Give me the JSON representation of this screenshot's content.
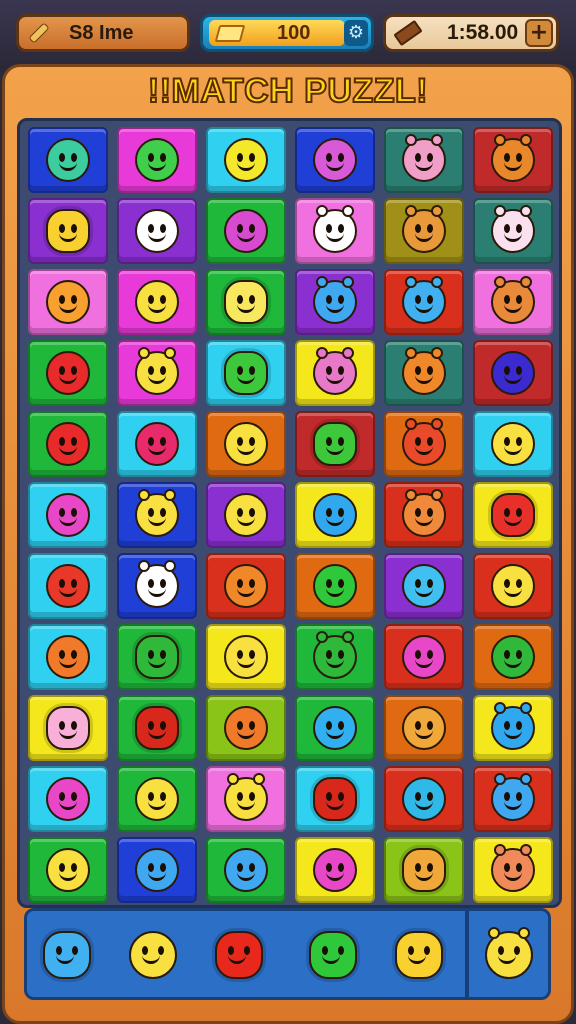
{
  "hud": {
    "player_label": "S8 Ime",
    "coins_value": "100",
    "timer_value": "1:58.00",
    "plus_label": "+",
    "settings_icon": "gear-icon"
  },
  "title": "!!MATCH PUZZL!",
  "colors": {
    "blue": "#1f3fd6",
    "magenta": "#e83ad8",
    "cyan": "#2fd0f0",
    "teal": "#2a7f72",
    "red": "#d8301c",
    "purple": "#8a2fd0",
    "green": "#1fb83a",
    "olive": "#a09018",
    "pink": "#f070e0",
    "orange": "#e06a12",
    "yellow": "#f4e81c",
    "lime": "#8ac418",
    "darkred": "#c02a2a"
  },
  "board": {
    "rows": [
      [
        {
          "tile": "blue",
          "face": "#3ccca0",
          "type": "round"
        },
        {
          "tile": "magenta",
          "face": "#3fcf4a",
          "type": "round"
        },
        {
          "tile": "cyan",
          "face": "#f4e82a",
          "type": "round"
        },
        {
          "tile": "blue",
          "face": "#d85ad8",
          "type": "round"
        },
        {
          "tile": "teal",
          "face": "#f0a0c8",
          "type": "eared"
        },
        {
          "tile": "darkred",
          "face": "#e8882a",
          "type": "eared"
        }
      ],
      [
        {
          "tile": "purple",
          "face": "#f8d030",
          "type": "spiky"
        },
        {
          "tile": "purple",
          "face": "#ffffff",
          "type": "round"
        },
        {
          "tile": "green",
          "face": "#d84ad0",
          "type": "round"
        },
        {
          "tile": "pink",
          "face": "#ffffff",
          "type": "eared"
        },
        {
          "tile": "olive",
          "face": "#e89a3a",
          "type": "eared"
        },
        {
          "tile": "teal",
          "face": "#fbe0f0",
          "type": "eared"
        }
      ],
      [
        {
          "tile": "pink",
          "face": "#f8a030",
          "type": "round"
        },
        {
          "tile": "magenta",
          "face": "#f8e040",
          "type": "round"
        },
        {
          "tile": "green",
          "face": "#f8e860",
          "type": "spiky"
        },
        {
          "tile": "purple",
          "face": "#40a8f0",
          "type": "eared"
        },
        {
          "tile": "red",
          "face": "#40b0f0",
          "type": "eared"
        },
        {
          "tile": "pink",
          "face": "#e88a3a",
          "type": "eared"
        }
      ],
      [
        {
          "tile": "green",
          "face": "#e82a2a",
          "type": "round"
        },
        {
          "tile": "magenta",
          "face": "#f8e040",
          "type": "eared"
        },
        {
          "tile": "cyan",
          "face": "#3cc83a",
          "type": "spiky"
        },
        {
          "tile": "yellow",
          "face": "#e878c8",
          "type": "eared"
        },
        {
          "tile": "teal",
          "face": "#f0882a",
          "type": "eared"
        },
        {
          "tile": "darkred",
          "face": "#3a2ad0",
          "type": "round"
        }
      ],
      [
        {
          "tile": "green",
          "face": "#e82a2a",
          "type": "round"
        },
        {
          "tile": "cyan",
          "face": "#e82a6a",
          "type": "round"
        },
        {
          "tile": "orange",
          "face": "#f8e040",
          "type": "round"
        },
        {
          "tile": "darkred",
          "face": "#3cc83a",
          "type": "spiky"
        },
        {
          "tile": "orange",
          "face": "#e84a2a",
          "type": "eared"
        },
        {
          "tile": "cyan",
          "face": "#f8e040",
          "type": "round"
        }
      ],
      [
        {
          "tile": "cyan",
          "face": "#e848c8",
          "type": "round"
        },
        {
          "tile": "blue",
          "face": "#f8e040",
          "type": "eared"
        },
        {
          "tile": "purple",
          "face": "#f8e040",
          "type": "round"
        },
        {
          "tile": "yellow",
          "face": "#30a8f0",
          "type": "round"
        },
        {
          "tile": "red",
          "face": "#f08a3a",
          "type": "eared"
        },
        {
          "tile": "yellow",
          "face": "#e8302a",
          "type": "spiky"
        }
      ],
      [
        {
          "tile": "cyan",
          "face": "#e8382a",
          "type": "round"
        },
        {
          "tile": "blue",
          "face": "#ffffff",
          "type": "eared"
        },
        {
          "tile": "red",
          "face": "#f0882a",
          "type": "round"
        },
        {
          "tile": "orange",
          "face": "#2fc83a",
          "type": "round"
        },
        {
          "tile": "purple",
          "face": "#40c0f0",
          "type": "round"
        },
        {
          "tile": "red",
          "face": "#f8e040",
          "type": "round"
        }
      ],
      [
        {
          "tile": "cyan",
          "face": "#f07a2a",
          "type": "round"
        },
        {
          "tile": "green",
          "face": "#2fb83a",
          "type": "spiky"
        },
        {
          "tile": "yellow",
          "face": "#f8e040",
          "type": "round"
        },
        {
          "tile": "green",
          "face": "#2fb83a",
          "type": "eared"
        },
        {
          "tile": "red",
          "face": "#e848c8",
          "type": "round"
        },
        {
          "tile": "orange",
          "face": "#2fb83a",
          "type": "round"
        }
      ],
      [
        {
          "tile": "yellow",
          "face": "#f8b0d8",
          "type": "spiky"
        },
        {
          "tile": "green",
          "face": "#d8281c",
          "type": "spiky"
        },
        {
          "tile": "lime",
          "face": "#f07a2a",
          "type": "round"
        },
        {
          "tile": "green",
          "face": "#30b0f0",
          "type": "round"
        },
        {
          "tile": "orange",
          "face": "#f0a83a",
          "type": "round"
        },
        {
          "tile": "yellow",
          "face": "#30a8f0",
          "type": "eared"
        }
      ],
      [
        {
          "tile": "cyan",
          "face": "#e848c8",
          "type": "round"
        },
        {
          "tile": "green",
          "face": "#f8e040",
          "type": "round"
        },
        {
          "tile": "pink",
          "face": "#f8e040",
          "type": "eared"
        },
        {
          "tile": "cyan",
          "face": "#d8281c",
          "type": "spiky"
        },
        {
          "tile": "red",
          "face": "#30b8e8",
          "type": "round"
        },
        {
          "tile": "red",
          "face": "#40a8f0",
          "type": "eared"
        }
      ],
      [
        {
          "tile": "green",
          "face": "#f8e040",
          "type": "round"
        },
        {
          "tile": "blue",
          "face": "#40a8f0",
          "type": "round"
        },
        {
          "tile": "green",
          "face": "#40a8f0",
          "type": "round"
        },
        {
          "tile": "yellow",
          "face": "#e848c8",
          "type": "round"
        },
        {
          "tile": "lime",
          "face": "#f0a83a",
          "type": "spiky"
        },
        {
          "tile": "yellow",
          "face": "#f08a5a",
          "type": "eared"
        }
      ]
    ]
  },
  "tray": {
    "items": [
      {
        "face": "#40b0f0",
        "type": "spiky"
      },
      {
        "face": "#f8e040",
        "type": "round"
      },
      {
        "face": "#e8281c",
        "type": "spiky"
      },
      {
        "face": "#2fc83a",
        "type": "spiky"
      },
      {
        "face": "#f8d030",
        "type": "spiky"
      },
      {
        "face": "#f8e040",
        "type": "eared"
      }
    ]
  }
}
